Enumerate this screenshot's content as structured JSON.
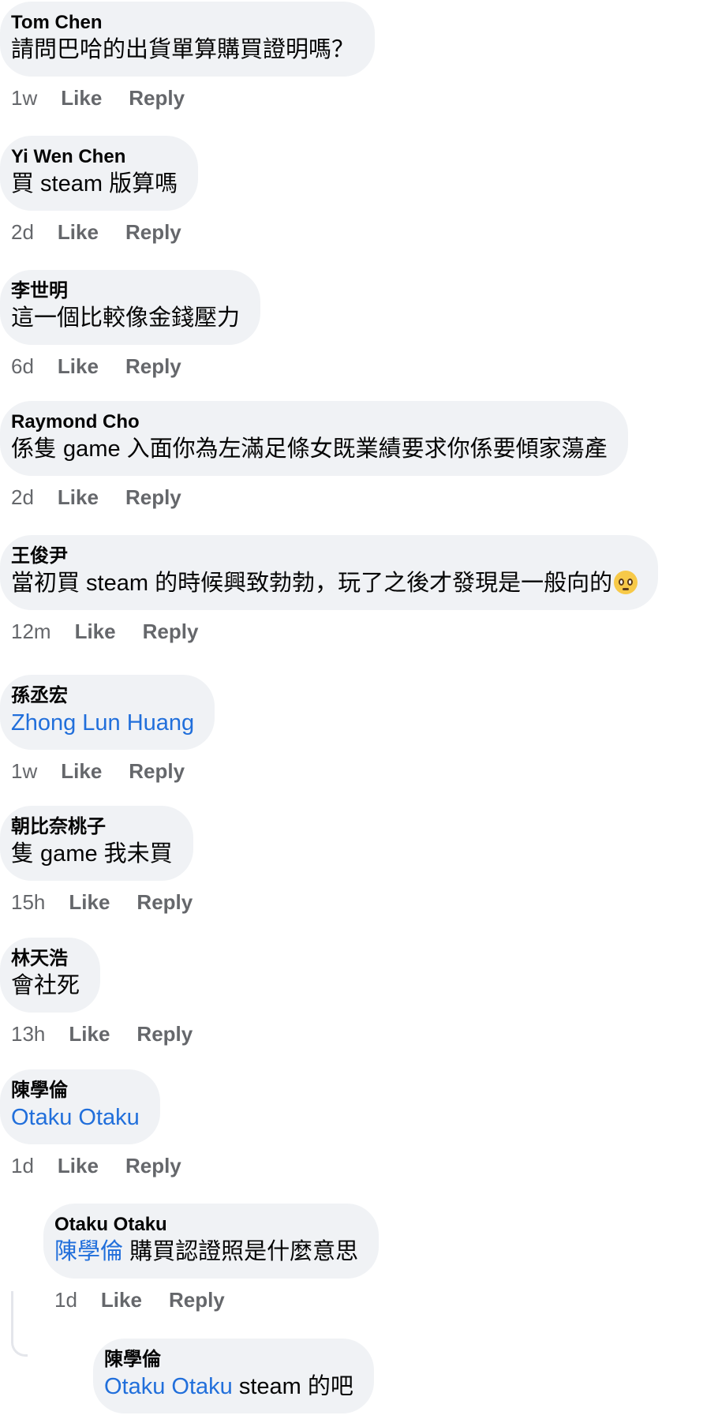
{
  "comments": [
    {
      "author": "Tom Chen",
      "text": "請問巴哈的出貨單算購買證明嗎？",
      "time": "1w",
      "like": "Like",
      "reply": "Reply"
    },
    {
      "author": "Yi Wen Chen",
      "text": "買 steam 版算嗎",
      "time": "2d",
      "like": "Like",
      "reply": "Reply"
    },
    {
      "author": "李世明",
      "text": "這一個比較像金錢壓力",
      "time": "6d",
      "like": "Like",
      "reply": "Reply"
    },
    {
      "author": "Raymond Cho",
      "text": "係隻 game 入面你為左滿足條女既業績要求你係要傾家蕩產",
      "time": "2d",
      "like": "Like",
      "reply": "Reply"
    },
    {
      "author": "王俊尹",
      "text": "當初買 steam 的時候興致勃勃，玩了之後才發現是一般向的",
      "emoji": "pleading-face",
      "time": "12m",
      "like": "Like",
      "reply": "Reply"
    },
    {
      "author": "孫丞宏",
      "mention": "Zhong Lun Huang",
      "time": "1w",
      "like": "Like",
      "reply": "Reply"
    },
    {
      "author": "朝比奈桃子",
      "text": "隻 game 我未買",
      "time": "15h",
      "like": "Like",
      "reply": "Reply"
    },
    {
      "author": "林天浩",
      "text": "會社死",
      "time": "13h",
      "like": "Like",
      "reply": "Reply"
    },
    {
      "author": "陳學倫",
      "mention": "Otaku Otaku",
      "time": "1d",
      "like": "Like",
      "reply": "Reply"
    }
  ],
  "replies": [
    {
      "author": "Otaku Otaku",
      "mention": "陳學倫",
      "text": " 購買認證照是什麼意思",
      "time": "1d",
      "like": "Like",
      "reply": "Reply"
    },
    {
      "author": "陳學倫",
      "mention": "Otaku Otaku",
      "text": " steam 的吧"
    }
  ],
  "colors": {
    "bubble": "#f0f2f5",
    "text": "#050505",
    "meta": "#65676b",
    "mention": "#216fdb"
  }
}
